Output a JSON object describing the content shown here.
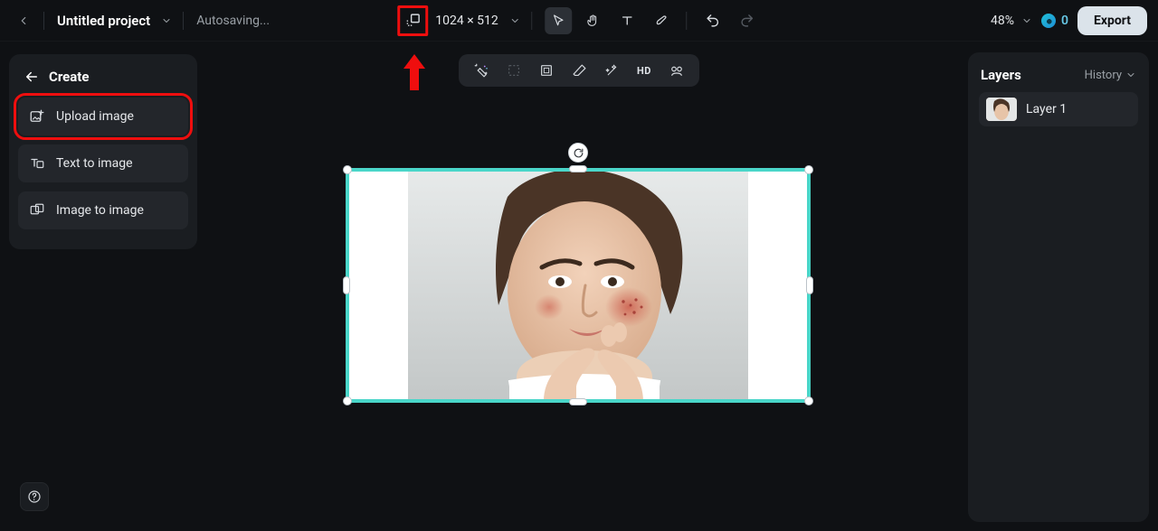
{
  "header": {
    "project_title": "Untitled project",
    "autosave_status": "Autosaving...",
    "canvas_dimensions": "1024 × 512",
    "zoom": "48%",
    "credits": "0",
    "export_label": "Export"
  },
  "sidebar": {
    "back_to_label": "Create",
    "items": [
      {
        "label": "Upload image",
        "icon": "upload-image-icon",
        "highlighted": true
      },
      {
        "label": "Text to image",
        "icon": "text-to-image-icon",
        "highlighted": false
      },
      {
        "label": "Image to image",
        "icon": "image-to-image-icon",
        "highlighted": false
      }
    ]
  },
  "canvas": {
    "selected": true
  },
  "layers_panel": {
    "title": "Layers",
    "history_label": "History",
    "layers": [
      {
        "name": "Layer 1"
      }
    ]
  },
  "annotations": {
    "resize_tool_highlighted": true,
    "arrow_target": "resize-canvas-button",
    "upload_image_highlighted": true
  }
}
